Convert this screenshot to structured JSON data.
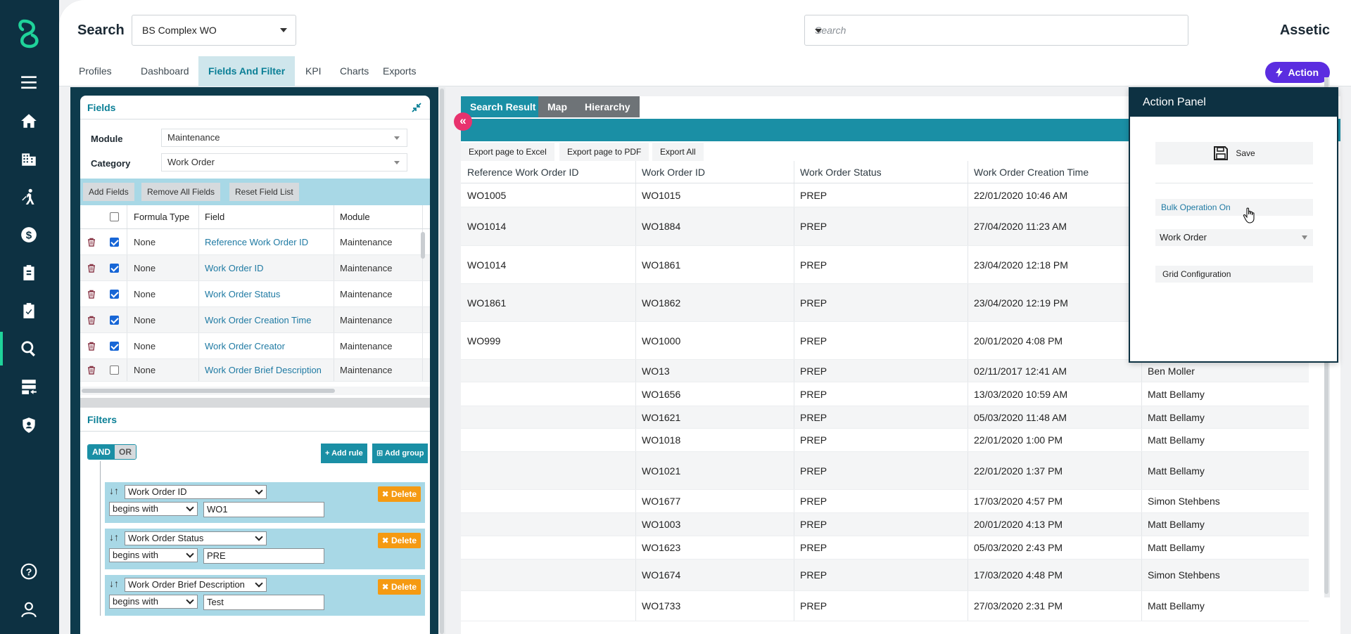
{
  "topbar": {
    "title": "Search",
    "profile_select": "BS Complex WO",
    "search_placeholder": "Search",
    "brand": "Assetic"
  },
  "tabs": [
    "Profiles",
    "Dashboard",
    "Fields And Filter",
    "KPI",
    "Charts",
    "Exports"
  ],
  "active_tab": "Fields And Filter",
  "action_button": "Action",
  "fields": {
    "title": "Fields",
    "module_label": "Module",
    "module_value": "Maintenance",
    "category_label": "Category",
    "category_value": "Work Order",
    "buttons": [
      "Add Fields",
      "Remove All Fields",
      "Reset Field List"
    ],
    "columns": [
      "Formula Type",
      "Field",
      "Module"
    ],
    "rows": [
      {
        "checked": true,
        "formula": "None",
        "field": "Reference Work Order ID",
        "module": "Maintenance"
      },
      {
        "checked": true,
        "formula": "None",
        "field": "Work Order ID",
        "module": "Maintenance"
      },
      {
        "checked": true,
        "formula": "None",
        "field": "Work Order Status",
        "module": "Maintenance"
      },
      {
        "checked": true,
        "formula": "None",
        "field": "Work Order Creation Time",
        "module": "Maintenance"
      },
      {
        "checked": true,
        "formula": "None",
        "field": "Work Order Creator",
        "module": "Maintenance"
      },
      {
        "checked": false,
        "formula": "None",
        "field": "Work Order Brief Description",
        "module": "Maintenance"
      }
    ]
  },
  "filters": {
    "title": "Filters",
    "and": "AND",
    "or": "OR",
    "add_rule": "Add rule",
    "add_group": "Add group",
    "delete": "Delete",
    "rules": [
      {
        "field": "Work Order ID",
        "op": "begins with",
        "value": "WO1"
      },
      {
        "field": "Work Order Status",
        "op": "begins with",
        "value": "PRE"
      },
      {
        "field": "Work Order Brief Description",
        "op": "begins with",
        "value": "Test"
      }
    ]
  },
  "results": {
    "tabs": [
      "Search Result",
      "Map",
      "Hierarchy"
    ],
    "exports": [
      "Export page to Excel",
      "Export page to PDF",
      "Export All"
    ],
    "columns": [
      "Reference Work Order ID",
      "Work Order ID",
      "Work Order Status",
      "Work Order Creation Time"
    ],
    "rows": [
      {
        "ref": "WO1005",
        "id": "WO1015",
        "status": "PREP",
        "time": "22/01/2020 10:46 AM",
        "creator": ""
      },
      {
        "ref": "WO1014",
        "id": "WO1884",
        "status": "PREP",
        "time": "27/04/2020 11:23 AM",
        "creator": ""
      },
      {
        "ref": "WO1014",
        "id": "WO1861",
        "status": "PREP",
        "time": "23/04/2020 12:18 PM",
        "creator": ""
      },
      {
        "ref": "WO1861",
        "id": "WO1862",
        "status": "PREP",
        "time": "23/04/2020 12:19 PM",
        "creator": ""
      },
      {
        "ref": "WO999",
        "id": "WO1000",
        "status": "PREP",
        "time": "20/01/2020 4:08 PM",
        "creator": ""
      },
      {
        "ref": "",
        "id": "WO13",
        "status": "PREP",
        "time": "02/11/2017 12:41 AM",
        "creator": "Ben Moller"
      },
      {
        "ref": "",
        "id": "WO1656",
        "status": "PREP",
        "time": "13/03/2020 10:59 AM",
        "creator": "Matt Bellamy"
      },
      {
        "ref": "",
        "id": "WO1621",
        "status": "PREP",
        "time": "05/03/2020 11:48 AM",
        "creator": "Matt Bellamy"
      },
      {
        "ref": "",
        "id": "WO1018",
        "status": "PREP",
        "time": "22/01/2020 1:00 PM",
        "creator": "Matt Bellamy"
      },
      {
        "ref": "",
        "id": "WO1021",
        "status": "PREP",
        "time": "22/01/2020 1:37 PM",
        "creator": "Matt Bellamy"
      },
      {
        "ref": "",
        "id": "WO1677",
        "status": "PREP",
        "time": "17/03/2020 4:57 PM",
        "creator": "Simon Stehbens"
      },
      {
        "ref": "",
        "id": "WO1003",
        "status": "PREP",
        "time": "20/01/2020 4:13 PM",
        "creator": "Matt Bellamy"
      },
      {
        "ref": "",
        "id": "WO1623",
        "status": "PREP",
        "time": "05/03/2020 2:43 PM",
        "creator": "Matt Bellamy"
      },
      {
        "ref": "",
        "id": "WO1674",
        "status": "PREP",
        "time": "17/03/2020 4:48 PM",
        "creator": "Simon Stehbens"
      },
      {
        "ref": "",
        "id": "WO1733",
        "status": "PREP",
        "time": "27/03/2020 2:31 PM",
        "creator": "Matt Bellamy"
      }
    ]
  },
  "action_panel": {
    "title": "Action Panel",
    "save": "Save",
    "bulk": "Bulk Operation On",
    "bulk_target": "Work Order",
    "grid_config": "Grid Configuration"
  },
  "colors": {
    "rail": "#0d3142",
    "teal": "#1a8fa5",
    "action": "#5b2de0",
    "delete": "#f59a12",
    "collapse": "#e8336e"
  }
}
